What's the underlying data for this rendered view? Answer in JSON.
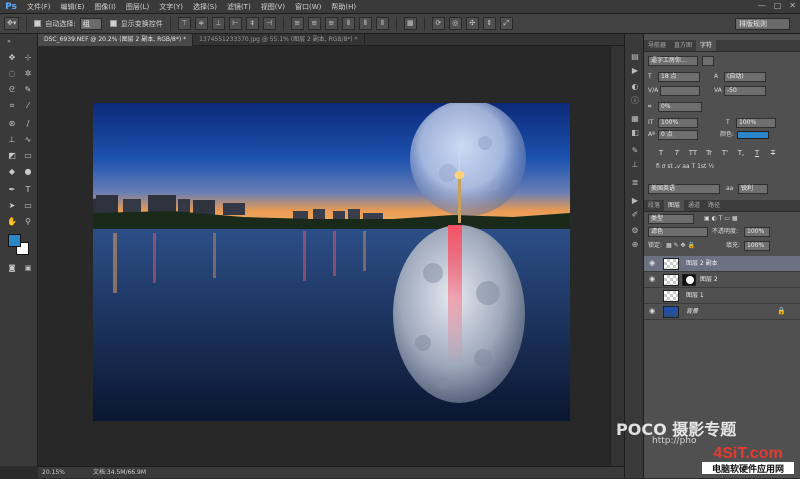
{
  "app": {
    "logo": "Ps"
  },
  "menu": [
    "文件(F)",
    "编辑(E)",
    "图像(I)",
    "图层(L)",
    "文字(Y)",
    "选择(S)",
    "滤镜(T)",
    "视图(V)",
    "窗口(W)",
    "帮助(H)"
  ],
  "options": {
    "auto_select_label": "自动选择:",
    "auto_select_value": "组",
    "show_transform_label": "显示变换控件",
    "workspace": "排版规则"
  },
  "tabs": [
    {
      "label": "DSC_6939.NEF @ 20.2% (图层 2 副本, RGB/8*) *",
      "active": true
    },
    {
      "label": "1374551233370.jpg @ 55.1% (图层 2 副本, RGB/8*) *",
      "active": false
    }
  ],
  "status": {
    "zoom": "20.15%",
    "doc": "文档:34.5M/66.9M"
  },
  "panels": {
    "top_tabs": [
      "导航器",
      "直方图",
      "字符"
    ],
    "character": {
      "font_family": "逼字工房你...",
      "font_size": "18 点",
      "leading": "(自动)",
      "tracking": "-50",
      "scale_percent": "0%",
      "vscale": "100%",
      "hscale": "100%",
      "baseline": "0 点",
      "color_label": "颜色:",
      "language": "美国英语",
      "aa_label": "aa",
      "aa_value": "锐利",
      "style_buttons": [
        "T",
        "T",
        "TT",
        "Tr",
        "T'",
        "T,",
        "T",
        "T"
      ]
    },
    "layer_tabs": [
      "段落",
      "图层",
      "通道",
      "路径"
    ],
    "layers": {
      "filter": "类型",
      "blend_mode": "滤色",
      "opacity_label": "不透明度:",
      "opacity": "100%",
      "lock_label": "锁定:",
      "fill_label": "填充:",
      "fill": "100%",
      "items": [
        {
          "name": "图层 2 副本",
          "visible": true,
          "selected": true
        },
        {
          "name": "图层 2",
          "visible": true,
          "selected": false
        },
        {
          "name": "图层 1",
          "visible": false,
          "selected": false
        },
        {
          "name": "背景",
          "visible": true,
          "selected": false
        }
      ]
    }
  },
  "watermarks": {
    "poco": "POCO 摄影专题",
    "url": "http://pho",
    "site": "4SiT.com",
    "site_cn": "电脑软硬件应用网"
  },
  "colors": {
    "foreground": "#2a86c8",
    "background": "#ffffff",
    "accent": "#6b7180"
  }
}
